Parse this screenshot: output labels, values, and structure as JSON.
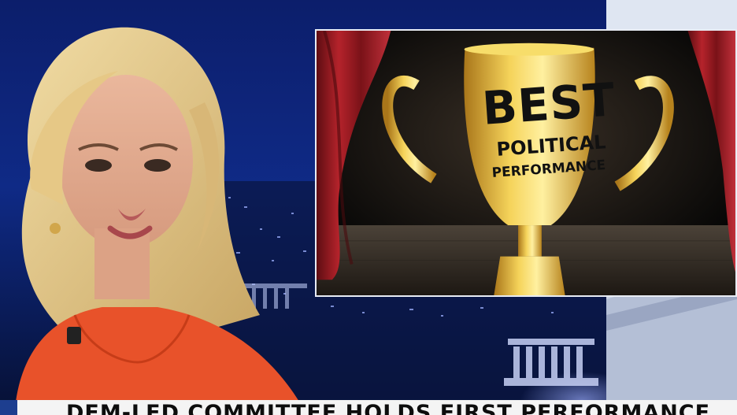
{
  "graphic": {
    "trophy_line1": "BEST",
    "trophy_line2": "POLITICAL",
    "trophy_line3": "PERFORMANCE"
  },
  "lower_third": {
    "headline": "DEM-LED COMMITTEE HOLDS FIRST PERFORMANCE"
  },
  "colors": {
    "background_blue": "#0a1a4a",
    "dress_orange": "#e8522a",
    "trophy_gold": "#d9a824",
    "curtain_red": "#9e1b22",
    "banner_white": "#f4f4f4"
  }
}
